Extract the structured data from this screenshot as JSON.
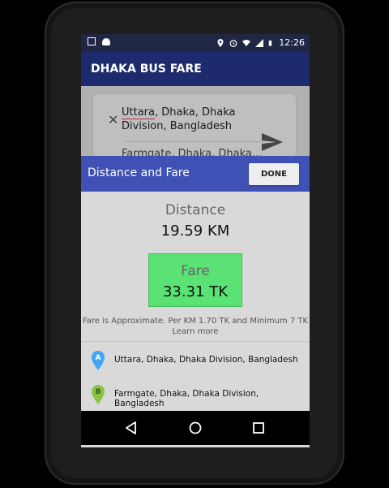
{
  "status_bar": {
    "time": "12:26"
  },
  "app_bar": {
    "title": "DHAKA BUS FARE"
  },
  "route_card": {
    "from_text_part1": "Uttara",
    "from_text_part2": ", Dhaka, Dhaka Division, Bangladesh",
    "to_text": "Farmgate, Dhaka, Dhaka..."
  },
  "dialog": {
    "title": "Distance and Fare",
    "done_label": "DONE",
    "distance_label": "Distance",
    "distance_value": "19.59 KM",
    "fare_label": "Fare",
    "fare_value": "33.31 TK",
    "note_line1": "Fare is Approximate. Per KM 1.70 TK and Minimum 7 TK",
    "note_line2": "Learn more",
    "locations": [
      {
        "marker": "A",
        "text": "Uttara, Dhaka, Dhaka Division, Bangladesh",
        "color": "#42a5f5"
      },
      {
        "marker": "B",
        "text": "Farmgate, Dhaka, Dhaka Division, Bangladesh",
        "color": "#8bc34a"
      }
    ]
  },
  "colors": {
    "status_bar": "#1f2745",
    "app_bar": "#1d2b6e",
    "dialog_header": "#3f51b5",
    "fare_box": "#5ae274"
  },
  "icons": {
    "status": [
      "screenshot-icon",
      "android-icon",
      "location-icon",
      "alarm-icon",
      "wifi-icon",
      "signal-icon",
      "battery-icon"
    ],
    "navigation": [
      "back-icon",
      "home-icon",
      "recents-icon"
    ],
    "route": [
      "clear-icon",
      "send-icon"
    ]
  }
}
